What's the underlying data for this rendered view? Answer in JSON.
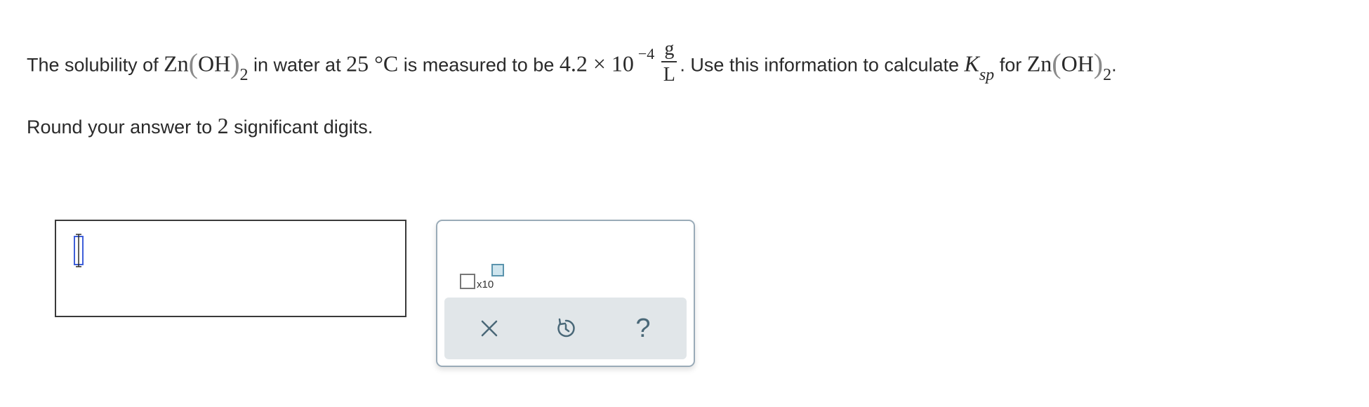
{
  "question": {
    "part1": "The solubility of ",
    "compound_element": "Zn",
    "compound_open_paren": "(",
    "compound_group": "OH",
    "compound_close_paren": ")",
    "compound_subscript": "2",
    "part2": " in water at ",
    "temperature": "25 °C",
    "part3": " is measured to be ",
    "mantissa": "4.2",
    "times": " × ",
    "base": "10",
    "exponent": "−4",
    "unit_numerator": "g",
    "unit_denominator": "L",
    "part4": ". Use this information to calculate ",
    "k_symbol": "K",
    "k_subscript": "sp",
    "part5": " for ",
    "part6": "."
  },
  "instruction": {
    "prefix": "Round your answer to ",
    "digits": "2",
    "suffix": " significant digits."
  },
  "answer": {
    "value": ""
  },
  "toolbox": {
    "sci_notation_label": "x10"
  },
  "icons": {
    "cursor": "text-cursor-icon",
    "clear": "close-icon",
    "undo": "undo-icon",
    "help": "question-mark-icon",
    "help_glyph": "?"
  },
  "colors": {
    "text": "#2a2a2a",
    "paren_gray": "#8a8a8a",
    "cursor_blue": "#3f5fd9",
    "toolbox_border": "#9aabb8",
    "toolbar_bg": "#e1e6e9",
    "icon_color": "#4a6878",
    "exp_box_fill": "#cfe5ee"
  }
}
